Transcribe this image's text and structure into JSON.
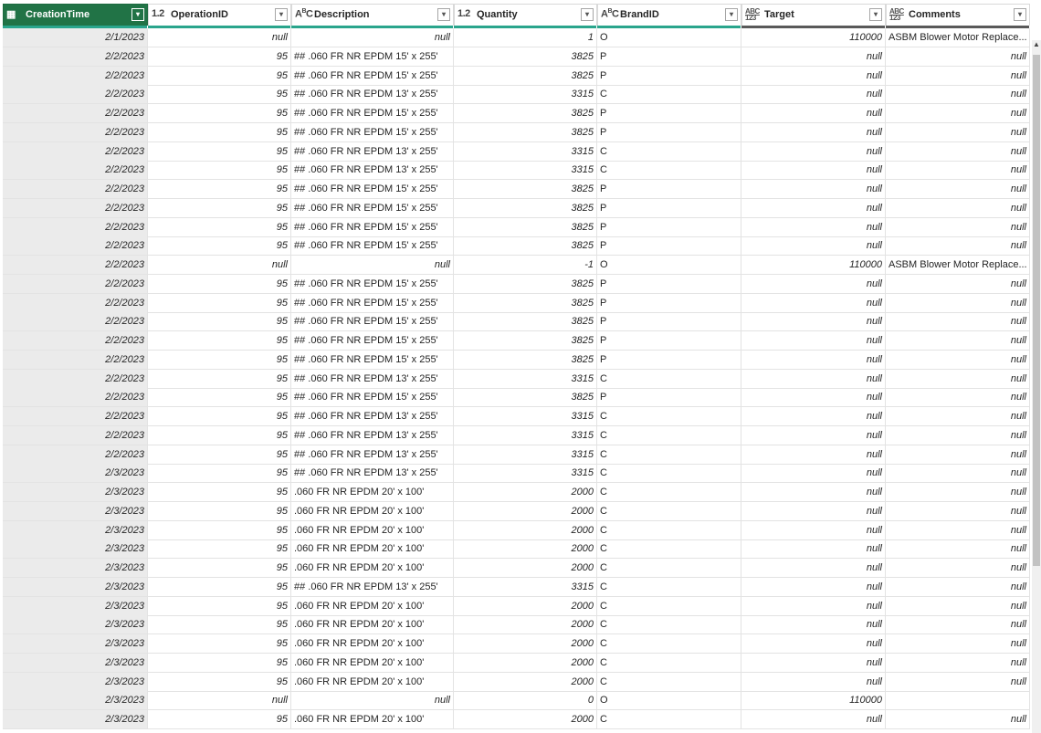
{
  "columns": [
    {
      "name": "CreationTime",
      "type_icon": "table-icon",
      "type_glyph": "▦",
      "filter_glyph": "▾"
    },
    {
      "name": "OperationID",
      "type_icon": "decimal-type-icon",
      "type_glyph": "1.2",
      "filter_glyph": "▾"
    },
    {
      "name": "Description",
      "type_icon": "text-type-icon",
      "type_glyph": "ABC",
      "filter_glyph": "▾"
    },
    {
      "name": "Quantity",
      "type_icon": "decimal-type-icon",
      "type_glyph": "1.2",
      "filter_glyph": "▾"
    },
    {
      "name": "BrandID",
      "type_icon": "text-type-icon",
      "type_glyph": "ABC",
      "filter_glyph": "▾"
    },
    {
      "name": "Target",
      "type_icon": "any-type-icon",
      "type_glyph": "ABC 123",
      "filter_glyph": "▾"
    },
    {
      "name": "Comments",
      "type_icon": "any-type-icon",
      "type_glyph": "ABC 123",
      "filter_glyph": "▾"
    }
  ],
  "scroll_up_glyph": "▲",
  "rows": [
    [
      "2/1/2023",
      "null",
      "null",
      "1",
      "O",
      "110000",
      "ASBM Blower Motor Replace..."
    ],
    [
      "2/2/2023",
      "95",
      "## .060 FR NR EPDM 15' x 255'",
      "3825",
      "P",
      "null",
      "null"
    ],
    [
      "2/2/2023",
      "95",
      "## .060 FR NR EPDM 15' x 255'",
      "3825",
      "P",
      "null",
      "null"
    ],
    [
      "2/2/2023",
      "95",
      "## .060 FR NR EPDM 13' x 255'",
      "3315",
      "C",
      "null",
      "null"
    ],
    [
      "2/2/2023",
      "95",
      "## .060 FR NR EPDM 15' x 255'",
      "3825",
      "P",
      "null",
      "null"
    ],
    [
      "2/2/2023",
      "95",
      "## .060 FR NR EPDM 15' x 255'",
      "3825",
      "P",
      "null",
      "null"
    ],
    [
      "2/2/2023",
      "95",
      "## .060 FR NR EPDM 13' x 255'",
      "3315",
      "C",
      "null",
      "null"
    ],
    [
      "2/2/2023",
      "95",
      "## .060 FR NR EPDM 13' x 255'",
      "3315",
      "C",
      "null",
      "null"
    ],
    [
      "2/2/2023",
      "95",
      "## .060 FR NR EPDM 15' x 255'",
      "3825",
      "P",
      "null",
      "null"
    ],
    [
      "2/2/2023",
      "95",
      "## .060 FR NR EPDM 15' x 255'",
      "3825",
      "P",
      "null",
      "null"
    ],
    [
      "2/2/2023",
      "95",
      "## .060 FR NR EPDM 15' x 255'",
      "3825",
      "P",
      "null",
      "null"
    ],
    [
      "2/2/2023",
      "95",
      "## .060 FR NR EPDM 15' x 255'",
      "3825",
      "P",
      "null",
      "null"
    ],
    [
      "2/2/2023",
      "null",
      "null",
      "-1",
      "O",
      "110000",
      "ASBM Blower Motor Replace..."
    ],
    [
      "2/2/2023",
      "95",
      "## .060 FR NR EPDM 15' x 255'",
      "3825",
      "P",
      "null",
      "null"
    ],
    [
      "2/2/2023",
      "95",
      "## .060 FR NR EPDM 15' x 255'",
      "3825",
      "P",
      "null",
      "null"
    ],
    [
      "2/2/2023",
      "95",
      "## .060 FR NR EPDM 15' x 255'",
      "3825",
      "P",
      "null",
      "null"
    ],
    [
      "2/2/2023",
      "95",
      "## .060 FR NR EPDM 15' x 255'",
      "3825",
      "P",
      "null",
      "null"
    ],
    [
      "2/2/2023",
      "95",
      "## .060 FR NR EPDM 15' x 255'",
      "3825",
      "P",
      "null",
      "null"
    ],
    [
      "2/2/2023",
      "95",
      "## .060 FR NR EPDM 13' x 255'",
      "3315",
      "C",
      "null",
      "null"
    ],
    [
      "2/2/2023",
      "95",
      "## .060 FR NR EPDM 15' x 255'",
      "3825",
      "P",
      "null",
      "null"
    ],
    [
      "2/2/2023",
      "95",
      "## .060 FR NR EPDM 13' x 255'",
      "3315",
      "C",
      "null",
      "null"
    ],
    [
      "2/2/2023",
      "95",
      "## .060 FR NR EPDM 13' x 255'",
      "3315",
      "C",
      "null",
      "null"
    ],
    [
      "2/2/2023",
      "95",
      "## .060 FR NR EPDM 13' x 255'",
      "3315",
      "C",
      "null",
      "null"
    ],
    [
      "2/3/2023",
      "95",
      "## .060 FR NR EPDM 13' x 255'",
      "3315",
      "C",
      "null",
      "null"
    ],
    [
      "2/3/2023",
      "95",
      ".060 FR NR EPDM 20' x 100'",
      "2000",
      "C",
      "null",
      "null"
    ],
    [
      "2/3/2023",
      "95",
      ".060 FR NR EPDM 20' x 100'",
      "2000",
      "C",
      "null",
      "null"
    ],
    [
      "2/3/2023",
      "95",
      ".060 FR NR EPDM 20' x 100'",
      "2000",
      "C",
      "null",
      "null"
    ],
    [
      "2/3/2023",
      "95",
      ".060 FR NR EPDM 20' x 100'",
      "2000",
      "C",
      "null",
      "null"
    ],
    [
      "2/3/2023",
      "95",
      ".060 FR NR EPDM 20' x 100'",
      "2000",
      "C",
      "null",
      "null"
    ],
    [
      "2/3/2023",
      "95",
      "## .060 FR NR EPDM 13' x 255'",
      "3315",
      "C",
      "null",
      "null"
    ],
    [
      "2/3/2023",
      "95",
      ".060 FR NR EPDM 20' x 100'",
      "2000",
      "C",
      "null",
      "null"
    ],
    [
      "2/3/2023",
      "95",
      ".060 FR NR EPDM 20' x 100'",
      "2000",
      "C",
      "null",
      "null"
    ],
    [
      "2/3/2023",
      "95",
      ".060 FR NR EPDM 20' x 100'",
      "2000",
      "C",
      "null",
      "null"
    ],
    [
      "2/3/2023",
      "95",
      ".060 FR NR EPDM 20' x 100'",
      "2000",
      "C",
      "null",
      "null"
    ],
    [
      "2/3/2023",
      "95",
      ".060 FR NR EPDM 20' x 100'",
      "2000",
      "C",
      "null",
      "null"
    ],
    [
      "2/3/2023",
      "null",
      "null",
      "0",
      "O",
      "110000",
      ""
    ],
    [
      "2/3/2023",
      "95",
      ".060 FR NR EPDM 20' x 100'",
      "2000",
      "C",
      "null",
      "null"
    ]
  ]
}
